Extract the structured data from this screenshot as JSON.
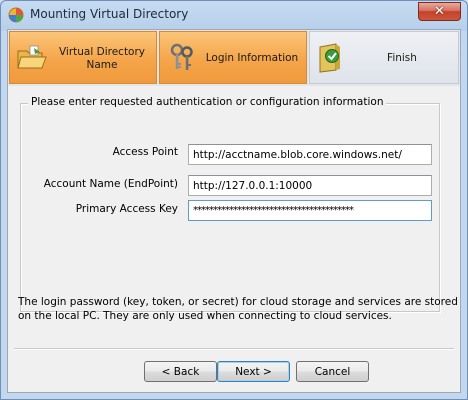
{
  "window": {
    "title": "Mounting Virtual Directory",
    "close_symbol": "✕"
  },
  "steps": [
    {
      "label": "Virtual Directory Name",
      "icon": "folder-open-icon",
      "state": "done"
    },
    {
      "label": "Login Information",
      "icon": "keys-icon",
      "state": "done"
    },
    {
      "label": "Finish",
      "icon": "folder-check-icon",
      "state": "pending"
    }
  ],
  "group": {
    "caption": "Please enter requested authentication or configuration information",
    "fields": [
      {
        "label": "Access Point",
        "value": "http://acctname.blob.core.windows.net/"
      },
      {
        "label": "Account Name (EndPoint)",
        "value": "http://127.0.0.1:10000"
      },
      {
        "label": "Primary Access Key",
        "value": "****************************************"
      }
    ]
  },
  "info_text": "The login password (key, token, or secret) for cloud storage and services are stored on the local PC. They are only used when connecting to cloud services.",
  "buttons": {
    "back": "< Back",
    "next": "Next >",
    "cancel": "Cancel"
  },
  "colors": {
    "step_done": "#f5a54a",
    "step_pending": "#e6e9ee",
    "titlebar": "#c6dbf1",
    "close_button": "#c2432c"
  }
}
